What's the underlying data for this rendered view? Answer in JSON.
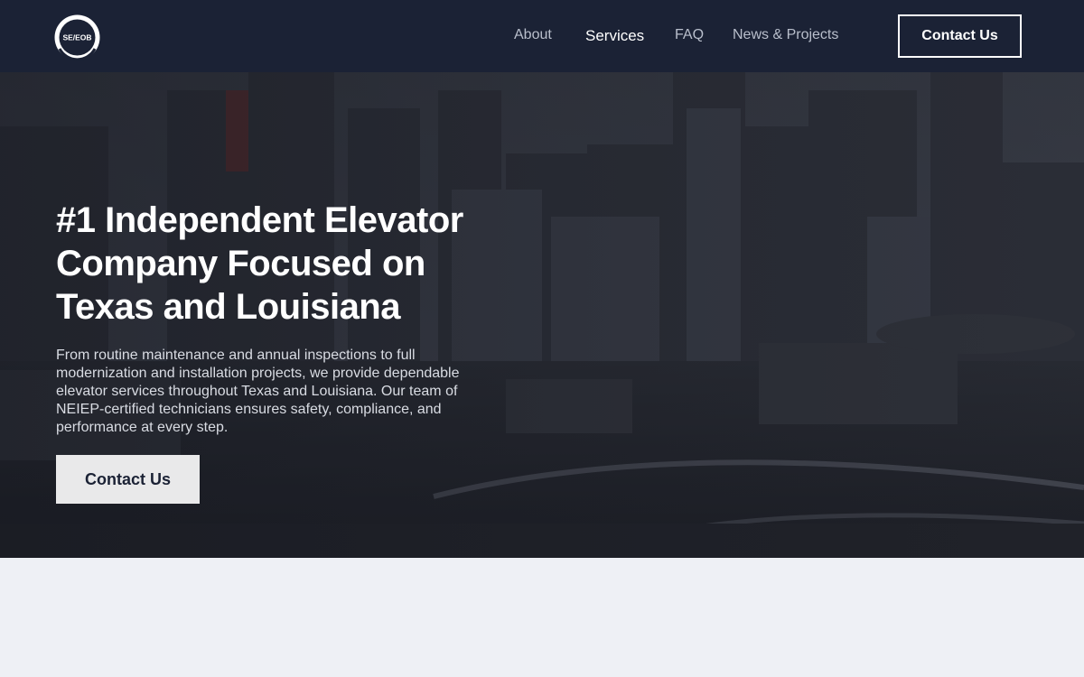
{
  "header": {
    "logo_text": "SE/EOB",
    "nav": [
      {
        "label": "About"
      },
      {
        "label": "Services"
      },
      {
        "label": "FAQ"
      },
      {
        "label": "News & Projects"
      }
    ],
    "contact_label": "Contact Us"
  },
  "hero": {
    "title": "#1 Independent Elevator Company Focused on Texas and Louisiana",
    "description": "From routine maintenance and annual inspections to full modernization and installation projects, we provide dependable elevator services throughout Texas and Louisiana. Our team of NEIEP-certified technicians ensures safety, compliance, and performance at every step.",
    "button_label": "Contact Us"
  },
  "colors": {
    "navbar": "#1b2235",
    "page_background": "#eef0f5",
    "hero_button": "#e9e9ea"
  }
}
